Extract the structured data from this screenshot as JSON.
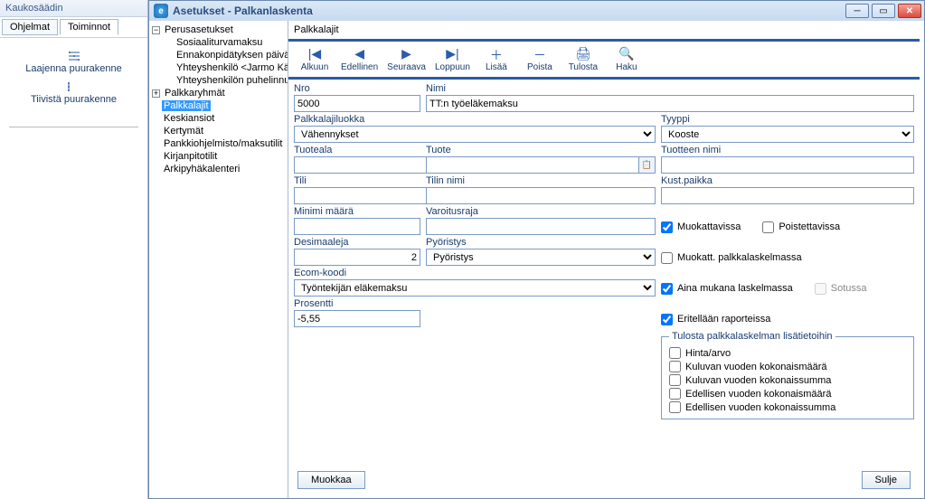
{
  "sidebar": {
    "title": "Kaukosäädin",
    "tabs": [
      "Ohjelmat",
      "Toiminnot"
    ],
    "active_tab": 1,
    "actions": {
      "expand": "Laajenna puurakenne",
      "collapse": "Tiivistä puurakenne"
    }
  },
  "window": {
    "title": "Asetukset - Palkanlaskenta",
    "icon_letter": "e"
  },
  "tree": {
    "root": "Perusasetukset",
    "root_children": [
      "Sosiaaliturvamaksu",
      "Ennakonpidätyksen päivära",
      "Yhteyshenkilö <Jarmo Kähk",
      "Yhteyshenkilön puhelinnum"
    ],
    "node2": "Palkkaryhmät",
    "items": [
      "Palkkalajit",
      "Keskiansiot",
      "Kertymät",
      "Pankkiohjelmisto/maksutilit",
      "Kirjanpitotilit",
      "Arkipyhäkalenteri"
    ],
    "selected": 0
  },
  "form": {
    "caption": "Palkkalajit",
    "toolbar": [
      {
        "icon": "|◀",
        "label": "Alkuun"
      },
      {
        "icon": "◀",
        "label": "Edellinen"
      },
      {
        "icon": "▶",
        "label": "Seuraava"
      },
      {
        "icon": "▶|",
        "label": "Loppuun"
      },
      {
        "icon": "＋",
        "label": "Lisää"
      },
      {
        "icon": "－",
        "label": "Poista"
      },
      {
        "icon": "🖨",
        "label": "Tulosta"
      },
      {
        "icon": "🔍",
        "label": "Haku"
      }
    ],
    "labels": {
      "nro": "Nro",
      "nimi": "Nimi",
      "palkkalajiluokka": "Palkkalajiluokka",
      "tyyppi": "Tyyppi",
      "tuoteala": "Tuoteala",
      "tuote": "Tuote",
      "tuotteen_nimi": "Tuotteen nimi",
      "tili": "Tili",
      "tilin_nimi": "Tilin nimi",
      "kust_paikka": "Kust.paikka",
      "minimi_maara": "Minimi määrä",
      "varoitusraja": "Varoitusraja",
      "desimaaleja": "Desimaaleja",
      "pyoristys": "Pyöristys",
      "ecom_koodi": "Ecom-koodi",
      "prosentti": "Prosentti",
      "muokattavissa": "Muokattavissa",
      "poistettavissa": "Poistettavissa",
      "muokatt_palkka": "Muokatt. palkkalaskelmassa",
      "aina_mukana": "Aina mukana laskelmassa",
      "sotussa": "Sotussa",
      "eritellaan": "Eritellään raporteissa",
      "print_legend": "Tulosta palkkalaskelman lisätietoihin",
      "hinta_arvo": "Hinta/arvo",
      "kuluvan_maara": "Kuluvan vuoden kokonaismäärä",
      "kuluvan_summa": "Kuluvan vuoden kokonaissumma",
      "edellisen_maara": "Edellisen vuoden kokonaismäärä",
      "edellisen_summa": "Edellisen vuoden kokonaissumma"
    },
    "values": {
      "nro": "5000",
      "nimi": "TT:n työeläkemaksu",
      "palkkalajiluokka": "Vähennykset",
      "tyyppi": "Kooste",
      "tuoteala": "",
      "tuote": "",
      "tuotteen_nimi": "",
      "tili": "",
      "tilin_nimi": "",
      "kust_paikka": "",
      "minimi_maara": "",
      "varoitusraja": "",
      "desimaaleja": "2",
      "pyoristys": "Pyöristys",
      "ecom_koodi": "Työntekijän eläkemaksu",
      "prosentti": "-5,55"
    },
    "checks": {
      "muokattavissa": true,
      "poistettavissa": false,
      "muokatt_palkka": false,
      "aina_mukana": true,
      "sotussa": false,
      "eritellaan": true,
      "hinta_arvo": false,
      "kuluvan_maara": false,
      "kuluvan_summa": false,
      "edellisen_maara": false,
      "edellisen_summa": false
    },
    "buttons": {
      "muokkaa": "Muokkaa",
      "sulje": "Sulje"
    }
  }
}
